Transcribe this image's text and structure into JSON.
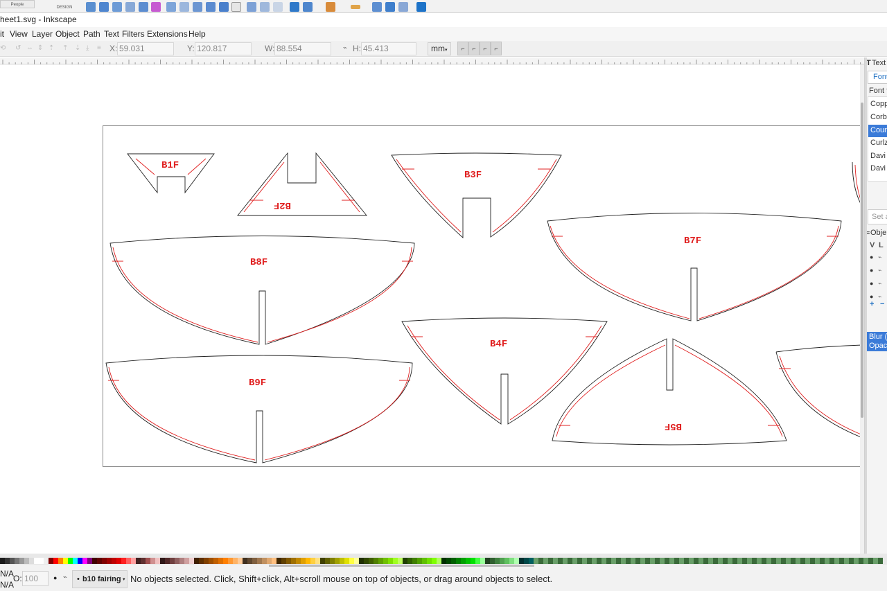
{
  "top_strip": {
    "people_label": "People",
    "design_label": "DESIGN"
  },
  "window": {
    "title": "heet1.svg - Inkscape"
  },
  "menu": [
    "it",
    "View",
    "Layer",
    "Object",
    "Path",
    "Text",
    "Filters",
    "Extensions",
    "Help"
  ],
  "tool_controls": {
    "x_label": "X:",
    "x_value": "59.031",
    "y_label": "Y:",
    "y_value": "120.817",
    "w_label": "W:",
    "w_value": "88.554",
    "h_label": "H:",
    "h_value": "45.413",
    "unit": "mm"
  },
  "parts": [
    "B1F",
    "B2F",
    "B3F",
    "B7F",
    "B8F",
    "B4F",
    "B9F",
    "B5F"
  ],
  "dock": {
    "text_panel_tab": "Text a",
    "font_tab": "Font",
    "font_family_label": "Font f",
    "fonts": [
      "Copp",
      "Corb",
      "Cour",
      "Curlz",
      "Davi",
      "Davi"
    ],
    "selected_font_index": 2,
    "sample_placeholder": "Set a",
    "objects_panel_tab": "Obje",
    "objects_cols": [
      "V",
      "L"
    ],
    "blur_label": "Blur (",
    "opacity_label": "Opac"
  },
  "status": {
    "fill_na": "N/A",
    "stroke_na": "N/A",
    "opacity_label": "O:",
    "opacity_value": "100",
    "layer_name": "b10 fairing",
    "message": "No objects selected. Click, Shift+click, Alt+scroll mouse on top of objects, or drag around objects to select."
  },
  "colors": {
    "cut_line": "#e02020",
    "selected_row": "#3b7bd8",
    "accent": "#1e73c8"
  }
}
